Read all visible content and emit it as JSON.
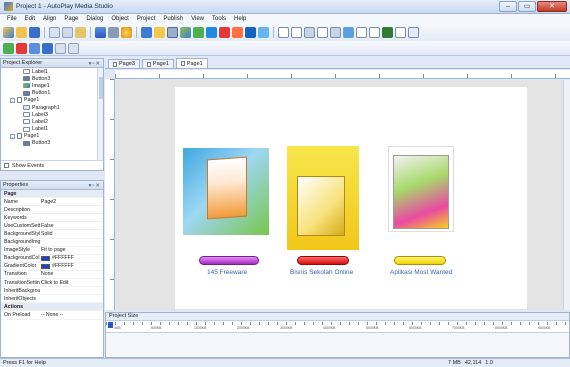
{
  "window": {
    "title": "Project 1 - AutoPlay Media Studio",
    "controls": [
      "–",
      "▭",
      "✕"
    ]
  },
  "menu": [
    "File",
    "Edit",
    "Align",
    "Page",
    "Dialog",
    "Object",
    "Project",
    "Publish",
    "View",
    "Tools",
    "Help"
  ],
  "explorer": {
    "title": "Project Explorer",
    "items": [
      {
        "label": "Label1",
        "icon": "label",
        "indent": 2
      },
      {
        "label": "Button3",
        "icon": "button",
        "indent": 2
      },
      {
        "label": "Image1",
        "icon": "image",
        "indent": 2
      },
      {
        "label": "Button1",
        "icon": "button",
        "indent": 2
      },
      {
        "label": "Page1",
        "icon": "page",
        "indent": 1
      },
      {
        "label": "Paragraph1",
        "icon": "para",
        "indent": 2
      },
      {
        "label": "Label3",
        "icon": "label",
        "indent": 2
      },
      {
        "label": "Label2",
        "icon": "label",
        "indent": 2
      },
      {
        "label": "Label1",
        "icon": "label",
        "indent": 2
      },
      {
        "label": "Page1",
        "icon": "page",
        "indent": 1
      },
      {
        "label": "Button3",
        "icon": "button",
        "indent": 2
      }
    ],
    "show_events": "Show Events"
  },
  "properties": {
    "title": "Properties",
    "rows": [
      {
        "key": "Page",
        "value": "",
        "group": true
      },
      {
        "key": "Name",
        "value": "Page2"
      },
      {
        "key": "Description",
        "value": ""
      },
      {
        "key": "Keywords",
        "value": ""
      },
      {
        "key": "UseCustomSett",
        "value": "False"
      },
      {
        "key": "BackgroundStyl",
        "value": "Solid"
      },
      {
        "key": "BackgroundImg",
        "value": ""
      },
      {
        "key": "ImageStyle",
        "value": "Fit to page"
      },
      {
        "key": "BackgroundCol",
        "value": "#FFFFFF",
        "swatch": "#1f3fd0"
      },
      {
        "key": "GradientColor",
        "value": "#FFFFFF",
        "swatch": "#1f3fd0"
      },
      {
        "key": "Transition",
        "value": "None"
      },
      {
        "key": "TransitionSettin",
        "value": "Click to Edit"
      },
      {
        "key": "InheritBackgrou",
        "value": ""
      },
      {
        "key": "InheritObjects",
        "value": ""
      },
      {
        "key": "Actions",
        "value": "",
        "group": true
      },
      {
        "key": "On Preload",
        "value": "-- None --"
      }
    ]
  },
  "tabs": [
    {
      "label": "Page3",
      "active": false
    },
    {
      "label": "Page1",
      "active": false
    },
    {
      "label": "Page1",
      "active": true
    }
  ],
  "captions": [
    "145 Freeware",
    "Bisnis Sekolah Online",
    "Aplikasi Most Wanted"
  ],
  "timeline": {
    "title": "Project Size",
    "ticks": [
      "0KB",
      "500KB",
      "1000KB",
      "2000KB",
      "3000KB",
      "4000KB",
      "5000KB",
      "6000KB",
      "7000KB",
      "8000KB",
      "9000KB"
    ]
  },
  "status": {
    "left": "Press F1 for Help",
    "mem": "7 MB",
    "size": "42,114",
    "zoom": "1.0"
  }
}
